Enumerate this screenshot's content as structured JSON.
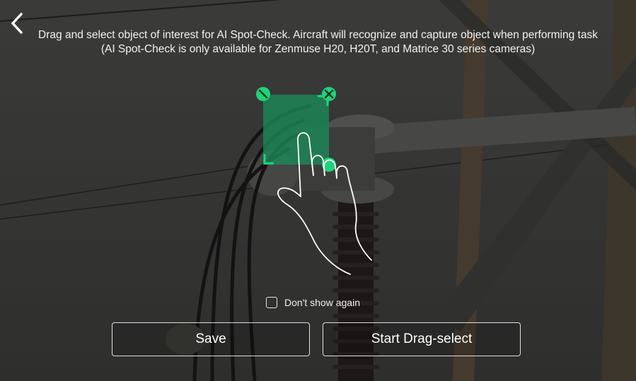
{
  "instructions": {
    "line1": "Drag and select object of interest for AI Spot-Check. Aircraft will recognize and capture object when performing task",
    "line2": "(AI Spot-Check is only available for Zenmuse H20, H20T, and Matrice 30 series cameras)"
  },
  "checkbox": {
    "label": "Don't show again",
    "checked": false
  },
  "buttons": {
    "save": "Save",
    "start": "Start Drag-select"
  },
  "icons": {
    "back": "chevron-left-icon",
    "close": "close-icon",
    "resize": "resize-icon"
  },
  "colors": {
    "accent": "#1fd37a",
    "selection_fill": "#1a8a57"
  }
}
